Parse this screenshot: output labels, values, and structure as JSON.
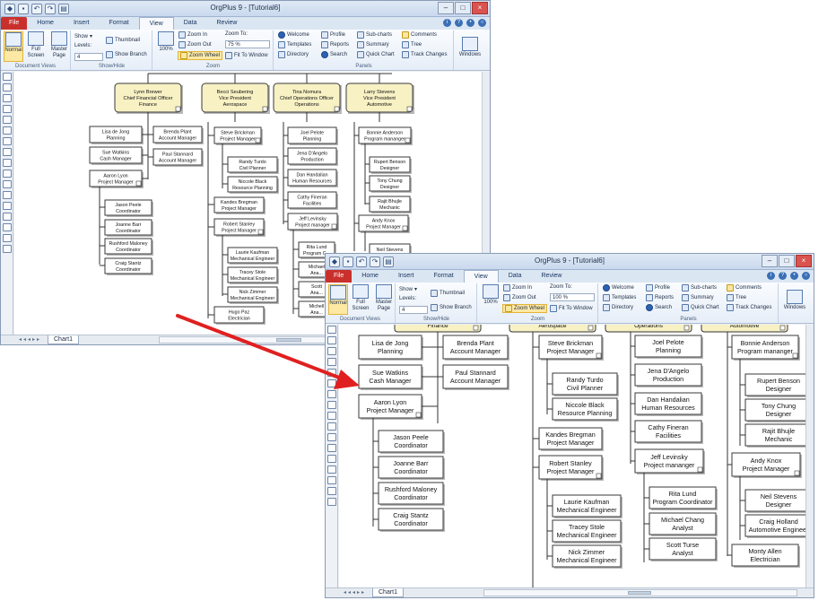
{
  "app": {
    "title": "OrgPlus 9 - [Tutorial6]",
    "tabs": [
      "File",
      "Home",
      "Insert",
      "Format",
      "View",
      "Data",
      "Review"
    ],
    "active_tab": "View",
    "sheet_tab": "Chart1"
  },
  "ribbon": {
    "document_views": {
      "label": "Document Views",
      "normal": "Normal",
      "full_screen": "Full Screen",
      "master_page": "Master Page"
    },
    "show_hide": {
      "label": "Show/Hide",
      "show": "Show",
      "levels": "Levels:",
      "levels_value": "4",
      "thumbnail": "Thumbnail",
      "show_branch": "Show Branch"
    },
    "zoom": {
      "label": "Zoom",
      "percent_btn": "100%",
      "zoom_in": "Zoom In",
      "zoom_out": "Zoom Out",
      "zoom_wheel": "Zoom Wheel",
      "zoom_to": "Zoom To:",
      "fit_to_window": "Fit To Window"
    },
    "panels": {
      "label": "Panels",
      "welcome": "Welcome",
      "templates": "Templates",
      "directory": "Directory",
      "profile": "Profile",
      "reports": "Reports",
      "search": "Search",
      "subcharts": "Sub-charts",
      "summary": "Summary",
      "quick_chart": "Quick Chart",
      "comments": "Comments",
      "tree": "Tree",
      "track_changes": "Track Changes"
    },
    "windows": "Windows"
  },
  "back_window": {
    "zoom_value": "75 %",
    "vps": [
      {
        "name": "Lynn Brewer",
        "title": "Chief Financial Officer",
        "dept": "Finance"
      },
      {
        "name": "Becci Seubering",
        "title": "Vice President",
        "dept": "Aerospace"
      },
      {
        "name": "Tina Nomura",
        "title": "Chief Operations Officer",
        "dept": "Operations"
      },
      {
        "name": "Larry Stevens",
        "title": "Vice President",
        "dept": "Automotive"
      }
    ],
    "boxes": [
      {
        "name": "Lisa de Jong",
        "title": "Planning"
      },
      {
        "name": "Sue Watkins",
        "title": "Cash Manager"
      },
      {
        "name": "Aaron Lyon",
        "title": "Project Manager"
      },
      {
        "name": "Jason Peele",
        "title": "Coordinator"
      },
      {
        "name": "Joanne Barr",
        "title": "Coordinator"
      },
      {
        "name": "Rushford Maloney",
        "title": "Coordinator"
      },
      {
        "name": "Craig Stantz",
        "title": "Coordinator"
      },
      {
        "name": "Brenda Plant",
        "title": "Account Manager"
      },
      {
        "name": "Paul Stannard",
        "title": "Account Manager"
      },
      {
        "name": "Steve Brickman",
        "title": "Project Manager"
      },
      {
        "name": "Randy Turdo",
        "title": "Civil Planner"
      },
      {
        "name": "Niccole Black",
        "title": "Resource Planning"
      },
      {
        "name": "Kandes Bregman",
        "title": "Project Manager"
      },
      {
        "name": "Robert Stanley",
        "title": "Project Manager"
      },
      {
        "name": "Laurie Kaufman",
        "title": "Mechanical Engineer"
      },
      {
        "name": "Tracey Stole",
        "title": "Mechanical Engineer"
      },
      {
        "name": "Nick Zimmer",
        "title": "Mechanical Engineer"
      },
      {
        "name": "Hugo Paz",
        "title": "Electrician"
      },
      {
        "name": "Joel Pelote",
        "title": "Planning"
      },
      {
        "name": "Jena D'Angelo",
        "title": "Production"
      },
      {
        "name": "Dan Handalian",
        "title": "Human Resources"
      },
      {
        "name": "Cathy Fineran",
        "title": "Facilities"
      },
      {
        "name": "Jeff Levinsky",
        "title": "Project manager"
      },
      {
        "name": "Rita Lund",
        "title": "Program C..."
      },
      {
        "name": "Michael",
        "title": "Ana..."
      },
      {
        "name": "Scott",
        "title": "Ana..."
      },
      {
        "name": "Michell",
        "title": "Ana..."
      },
      {
        "name": "Bonnie Anderson",
        "title": "Program mananger"
      },
      {
        "name": "Rupert Benson",
        "title": "Designer"
      },
      {
        "name": "Tony Chung",
        "title": "Designer"
      },
      {
        "name": "Rajit Bhujle",
        "title": "Mechanic"
      },
      {
        "name": "Andy Knox",
        "title": "Project Manager"
      },
      {
        "name": "Neil Stevens",
        "title": ""
      }
    ]
  },
  "front_window": {
    "zoom_value": "100 %",
    "vp_depts": [
      "Finance",
      "Aerospace",
      "Operations",
      "Automotive"
    ],
    "boxes": [
      {
        "name": "Lisa de Jong",
        "title": "Planning"
      },
      {
        "name": "Sue Watkins",
        "title": "Cash Manager"
      },
      {
        "name": "Aaron Lyon",
        "title": "Project Manager"
      },
      {
        "name": "Jason Peele",
        "title": "Coordinator"
      },
      {
        "name": "Joanne Barr",
        "title": "Coordinator"
      },
      {
        "name": "Rushford Maloney",
        "title": "Coordinator"
      },
      {
        "name": "Craig Stantz",
        "title": "Coordinator"
      },
      {
        "name": "Brenda Plant",
        "title": "Account Manager"
      },
      {
        "name": "Paul Stannard",
        "title": "Account Manager"
      },
      {
        "name": "Steve Brickman",
        "title": "Project Manager"
      },
      {
        "name": "Randy Turdo",
        "title": "Civil Planner"
      },
      {
        "name": "Niccole Black",
        "title": "Resource Planning"
      },
      {
        "name": "Kandes Bregman",
        "title": "Project Manager"
      },
      {
        "name": "Robert Stanley",
        "title": "Project Manager"
      },
      {
        "name": "Laurie Kaufman",
        "title": "Mechanical Engineer"
      },
      {
        "name": "Tracey Stole",
        "title": "Mechanical Engineer"
      },
      {
        "name": "Nick Zimmer",
        "title": "Mechanical Engineer"
      },
      {
        "name": "Joel Pelote",
        "title": "Planning"
      },
      {
        "name": "Jena D'Angelo",
        "title": "Production"
      },
      {
        "name": "Dan Handalian",
        "title": "Human Resources"
      },
      {
        "name": "Cathy Fineran",
        "title": "Facilities"
      },
      {
        "name": "Jeff Levinsky",
        "title": "Project mananger"
      },
      {
        "name": "Rita Lund",
        "title": "Program Coordinator"
      },
      {
        "name": "Michael Chang",
        "title": "Analyst"
      },
      {
        "name": "Scott Turse",
        "title": "Analyst"
      },
      {
        "name": "Bonnie Anderson",
        "title": "Program mananger"
      },
      {
        "name": "Rupert Benson",
        "title": "Designer"
      },
      {
        "name": "Tony Chung",
        "title": "Designer"
      },
      {
        "name": "Rajit Bhujle",
        "title": "Mechanic"
      },
      {
        "name": "Andy Knox",
        "title": "Project Manager"
      },
      {
        "name": "Neil Stevens",
        "title": "Designer"
      },
      {
        "name": "Craig Holland",
        "title": "Automotive Engineer"
      },
      {
        "name": "Monty Allen",
        "title": "Electrician"
      }
    ]
  },
  "colors": {
    "arrow": "#e02020",
    "vp_fill": "#f7f1c4",
    "box_border": "#3a3a3a",
    "file_tab": "#c9302c"
  }
}
